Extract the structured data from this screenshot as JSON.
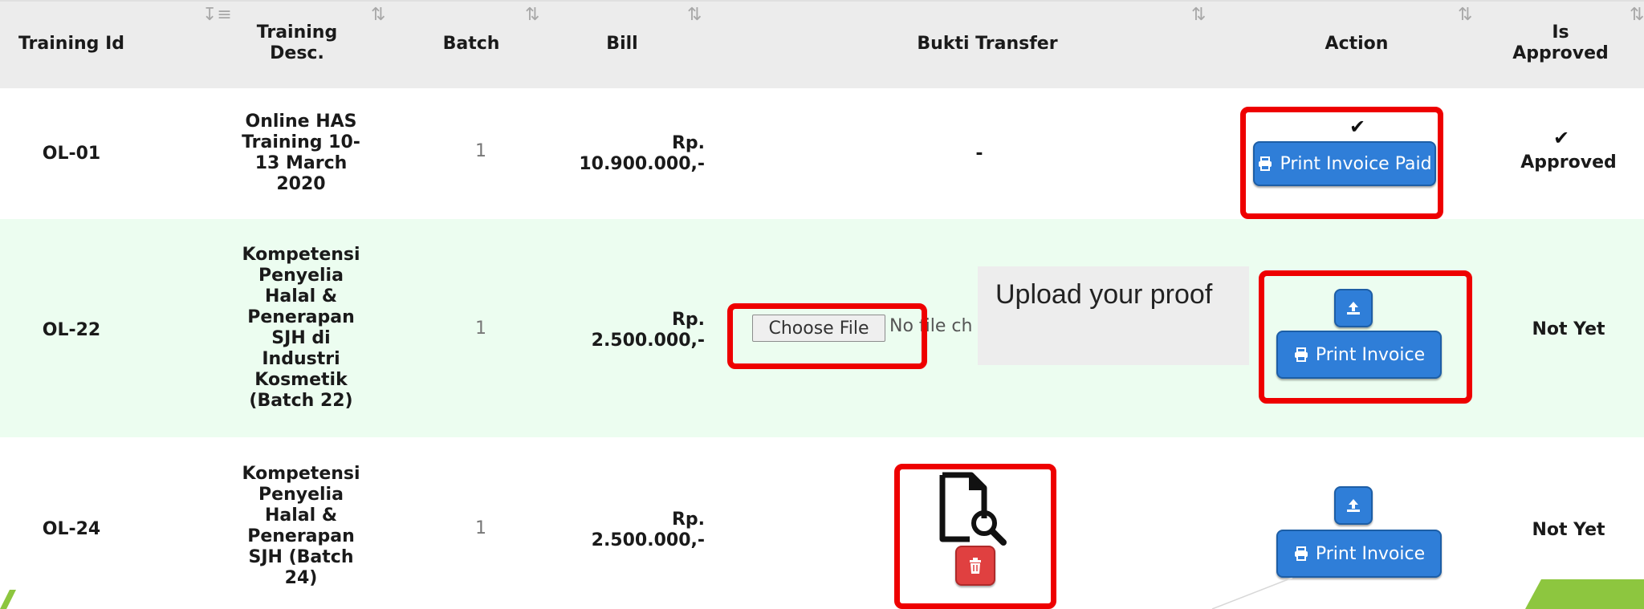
{
  "table": {
    "headers": {
      "training_id": "Training Id",
      "training_desc": "Training Desc.",
      "batch": "Batch",
      "bill": "Bill",
      "bukti_transfer": "Bukti Transfer",
      "action": "Action",
      "is_approved": "Is Approved"
    },
    "rows": [
      {
        "training_id": "OL-01",
        "training_desc": "Online HAS Training 10-13 March 2020",
        "batch": "1",
        "bill": "Rp. 10.900.000,-",
        "bukti_transfer": "-",
        "action_label": "Print Invoice Paid",
        "is_approved": "Approved"
      },
      {
        "training_id": "OL-22",
        "training_desc": "Kompetensi Penyelia Halal & Penerapan SJH di Industri Kosmetik (Batch 22)",
        "batch": "1",
        "bill": "Rp. 2.500.000,-",
        "file_button": "Choose File",
        "file_status": "No file ch",
        "action_label": "Print Invoice",
        "is_approved": "Not Yet"
      },
      {
        "training_id": "OL-24",
        "training_desc": "Kompetensi Penyelia Halal & Penerapan SJH (Batch 24)",
        "batch": "1",
        "bill": "Rp. 2.500.000,-",
        "action_label": "Print Invoice",
        "is_approved": "Not Yet"
      }
    ]
  },
  "callout": {
    "text": "Upload your proof"
  },
  "colors": {
    "header_bg": "#ececec",
    "highlight_row": "#ecfdf0",
    "primary_button": "#2f7ed8",
    "danger_button": "#e04040",
    "annotation_red": "#ee0000"
  },
  "icons": [
    "sort-icon",
    "check-icon",
    "print-icon",
    "upload-icon",
    "file-search-icon",
    "trash-icon"
  ]
}
